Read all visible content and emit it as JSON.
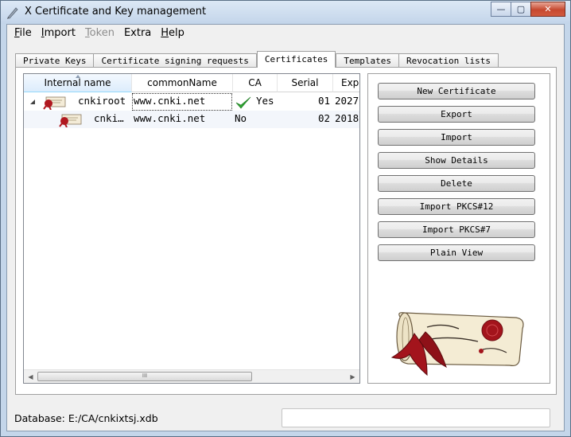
{
  "window": {
    "title": "X Certificate and Key management",
    "controls": {
      "minimize": "—",
      "maximize": "▢",
      "close": "✕"
    }
  },
  "menu": [
    {
      "label": "File",
      "mnemonic": "F",
      "rest": "ile",
      "enabled": true
    },
    {
      "label": "Import",
      "mnemonic": "I",
      "rest": "mport",
      "enabled": true
    },
    {
      "label": "Token",
      "mnemonic": "T",
      "rest": "oken",
      "enabled": false
    },
    {
      "label": "Extra",
      "mnemonic": "",
      "rest": "Extra",
      "enabled": true
    },
    {
      "label": "Help",
      "mnemonic": "H",
      "rest": "elp",
      "enabled": true
    }
  ],
  "tabs": [
    {
      "label": "Private Keys"
    },
    {
      "label": "Certificate signing requests"
    },
    {
      "label": "Certificates",
      "active": true
    },
    {
      "label": "Templates"
    },
    {
      "label": "Revocation lists"
    }
  ],
  "table": {
    "columns": [
      "Internal name",
      "commonName",
      "CA",
      "Serial",
      "Exp"
    ],
    "rows": [
      {
        "name": "cnkiroot",
        "commonName": "www.cnki.net",
        "ca": "Yes",
        "serial": "01",
        "expiry": "2027-",
        "expanded": true
      },
      {
        "name": "cnki…",
        "commonName": "www.cnki.net",
        "ca": "No",
        "serial": "02",
        "expiry": "2018-"
      }
    ],
    "scroll_grip": "III"
  },
  "buttons": {
    "new_certificate": "New Certificate",
    "export": "Export",
    "import": "Import",
    "show_details": "Show Details",
    "delete": "Delete",
    "import_pkcs12": "Import PKCS#12",
    "import_pkcs7": "Import PKCS#7",
    "plain_view": "Plain View"
  },
  "status": {
    "database": "Database: E:/CA/cnkixtsj.xdb"
  },
  "colors": {
    "titlebar": "#c4d6ea",
    "close_button": "#c6482f",
    "check_green": "#2fa632",
    "seal_red": "#a3141c"
  }
}
